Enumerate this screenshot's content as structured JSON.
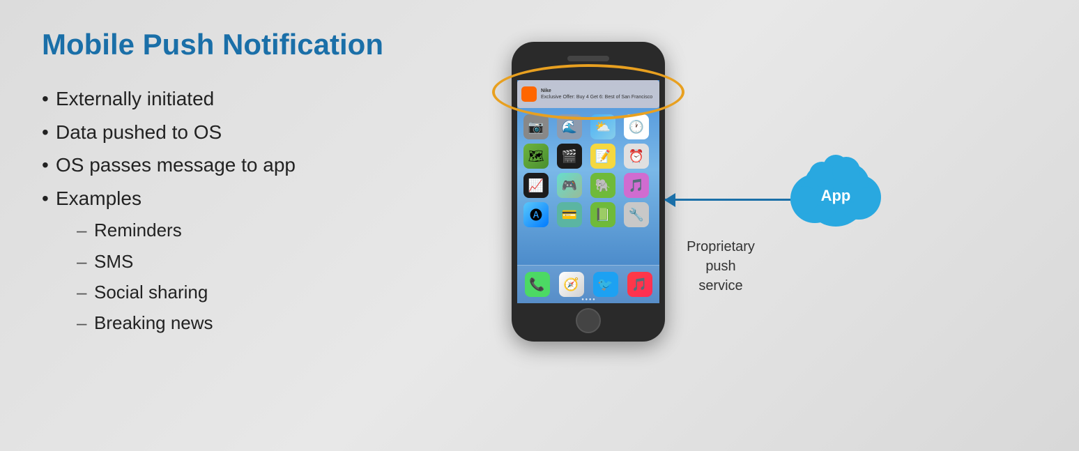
{
  "slide": {
    "title": "Mobile Push Notification",
    "bullets": [
      {
        "text": "Externally initiated",
        "sub": []
      },
      {
        "text": "Data pushed to OS",
        "sub": []
      },
      {
        "text": "OS passes message to app",
        "sub": []
      },
      {
        "text": "Examples",
        "sub": [
          "Reminders",
          "SMS",
          "Social sharing",
          "Breaking news"
        ]
      }
    ],
    "notification": {
      "title": "Nike",
      "body": "Exclusive Offer: Buy 4 Get 6: Best of San Francisco"
    },
    "cloud_label": "App",
    "push_service_label": "Proprietary\npush\nservice"
  }
}
